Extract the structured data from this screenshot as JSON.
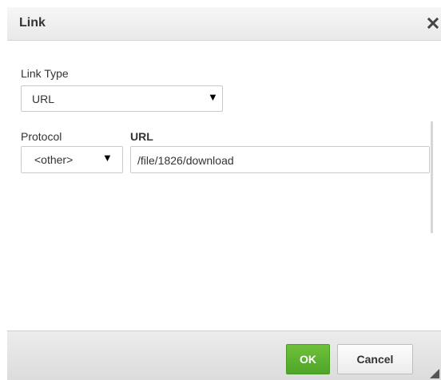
{
  "dialog": {
    "title": "Link",
    "close_glyph": "✕"
  },
  "fields": {
    "link_type_label": "Link Type",
    "link_type_value": "URL",
    "protocol_label": "Protocol",
    "protocol_value": "<other>",
    "url_label": "URL",
    "url_value": "/file/1826/download",
    "dropdown_arrow": "▼"
  },
  "footer": {
    "ok_label": "OK",
    "cancel_label": "Cancel"
  },
  "colors": {
    "ok_green": "#5cb531",
    "title_bg": "#ececec",
    "footer_bg": "#e3e3e3"
  },
  "icons": [
    "close-icon",
    "dropdown-arrow-icon",
    "resize-handle-icon"
  ]
}
